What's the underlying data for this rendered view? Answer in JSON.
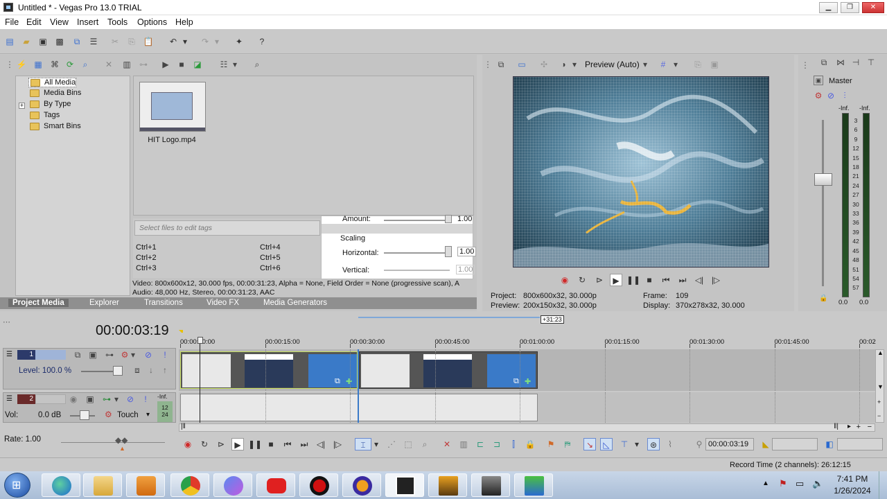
{
  "window": {
    "title": "Untitled * - Vegas Pro 13.0 TRIAL",
    "min": "▁",
    "max": "❐",
    "close": "✕"
  },
  "menu": [
    "File",
    "Edit",
    "View",
    "Insert",
    "Tools",
    "Options",
    "Help"
  ],
  "project_media": {
    "tree": [
      "All Media",
      "Media Bins",
      "By Type",
      "Tags",
      "Smart Bins"
    ],
    "tree_expander": "+",
    "file_name": "HIT Logo.mp4",
    "tags_placeholder": "Select files to edit tags",
    "shortcuts": [
      "Ctrl+1",
      "Ctrl+4",
      "Ctrl+2",
      "Ctrl+5",
      "Ctrl+3",
      "Ctrl+6"
    ],
    "info_line1": "Video: 800x600x12, 30.000 fps, 00:00:31:23, Alpha = None, Field Order = None (progressive scan), A",
    "info_line2": "Audio: 48,000 Hz, Stereo, 00:00:31:23, AAC"
  },
  "fx": {
    "amount_label": "Amount:",
    "amount_value": "1.00",
    "scaling_label": "Scaling",
    "horizontal_label": "Horizontal:",
    "horizontal_value": "1.00",
    "vertical_label": "Vertical:",
    "vertical_value": "1.00"
  },
  "tabs": [
    "Project Media",
    "Explorer",
    "Transitions",
    "Video FX",
    "Media Generators"
  ],
  "preview": {
    "mode": "Preview (Auto)",
    "project_label": "Project:",
    "project_value": "800x600x32, 30.000p",
    "preview_label": "Preview:",
    "preview_value": "200x150x32, 30.000p",
    "frame_label": "Frame:",
    "frame_value": "109",
    "display_label": "Display:",
    "display_value": "370x278x32, 30.000"
  },
  "mixer": {
    "title": "Master",
    "inf_left": "-Inf.",
    "inf_right": "-Inf.",
    "ticks": [
      "3",
      "6",
      "9",
      "12",
      "15",
      "18",
      "21",
      "24",
      "27",
      "30",
      "33",
      "36",
      "39",
      "42",
      "45",
      "48",
      "51",
      "54",
      "57"
    ],
    "zero_left": "0.0",
    "zero_right": "0.0"
  },
  "timeline": {
    "timecode": "00:00:03:19",
    "loop_badge": "+31:23",
    "ruler": [
      "00:00:00:00",
      "00:00:15:00",
      "00:00:30:00",
      "00:00:45:00",
      "00:01:00:00",
      "00:01:15:00",
      "00:01:30:00",
      "00:01:45:00",
      "00:02"
    ],
    "track1": {
      "number": "1",
      "level_label": "Level: 100.0 %"
    },
    "track2": {
      "number": "2",
      "vol_label": "Vol:",
      "vol_value": "0.0 dB",
      "mode": "Touch",
      "inf": "-Inf.",
      "meter_a": "12",
      "meter_b": "24"
    },
    "rate_label": "Rate: 1.00",
    "cursor_time": "00:00:03:19",
    "record_time": "Record Time (2 channels): 26:12:15"
  },
  "taskbar": {
    "time": "7:41 PM",
    "date": "1/26/2024"
  },
  "colors": {
    "accent": "#2f6fbf",
    "video_dark": "#1e3a4a",
    "video_light": "#8fb6cc"
  }
}
